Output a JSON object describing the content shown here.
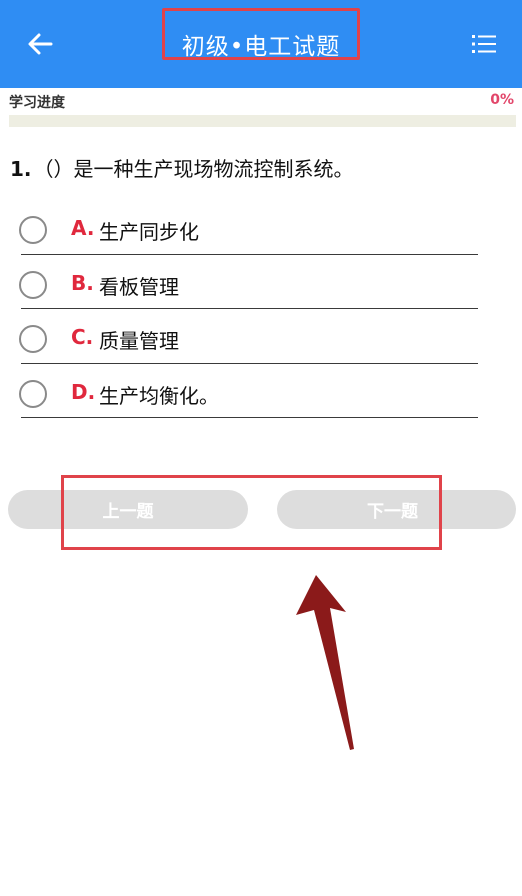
{
  "header": {
    "title": "初级•电工试题",
    "back_icon": "back-arrow-icon",
    "menu_icon": "list-menu-icon",
    "background": "#2f8df3"
  },
  "progress": {
    "label": "学习进度",
    "percent_text": "0%",
    "value": 0
  },
  "question": {
    "number": "1.",
    "text": "（）是一种生产现场物流控制系统。"
  },
  "options": [
    {
      "letter": "A.",
      "text": "生产同步化"
    },
    {
      "letter": "B.",
      "text": "看板管理"
    },
    {
      "letter": "C.",
      "text": "质量管理"
    },
    {
      "letter": "D.",
      "text": "生产均衡化。"
    }
  ],
  "nav": {
    "prev_label": "上一题",
    "next_label": "下一题"
  },
  "colors": {
    "accent": "#2f8df3",
    "option_letter": "#e0283d",
    "highlight_box": "#e0434a",
    "annotation_arrow": "#8b1a1a"
  }
}
